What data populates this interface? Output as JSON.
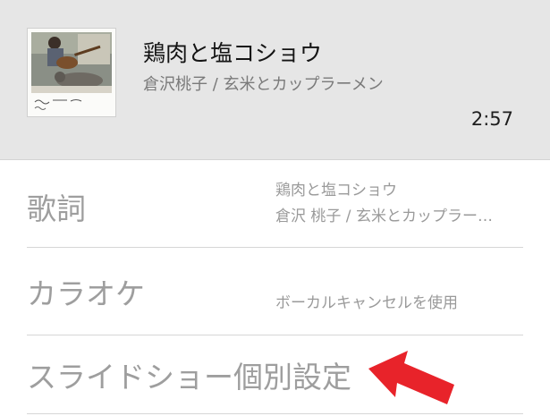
{
  "now_playing": {
    "title": "鶏肉と塩コショウ",
    "artist": "倉沢桃子 / 玄米とカップラーメン",
    "duration": "2:57"
  },
  "settings": {
    "lyrics": {
      "label": "歌詞",
      "value_line1": "鶏肉と塩コショウ",
      "value_line2": "倉沢 桃子 / 玄米とカップラー…"
    },
    "karaoke": {
      "label": "カラオケ",
      "value": "ボーカルキャンセルを使用"
    },
    "slideshow": {
      "label": "スライドショー個別設定"
    }
  },
  "colors": {
    "header_bg": "#e6e6e6",
    "label_gray": "#9e9e9e",
    "arrow_red": "#e8232a"
  },
  "icons": {
    "pointer": "red-arrow-icon"
  }
}
